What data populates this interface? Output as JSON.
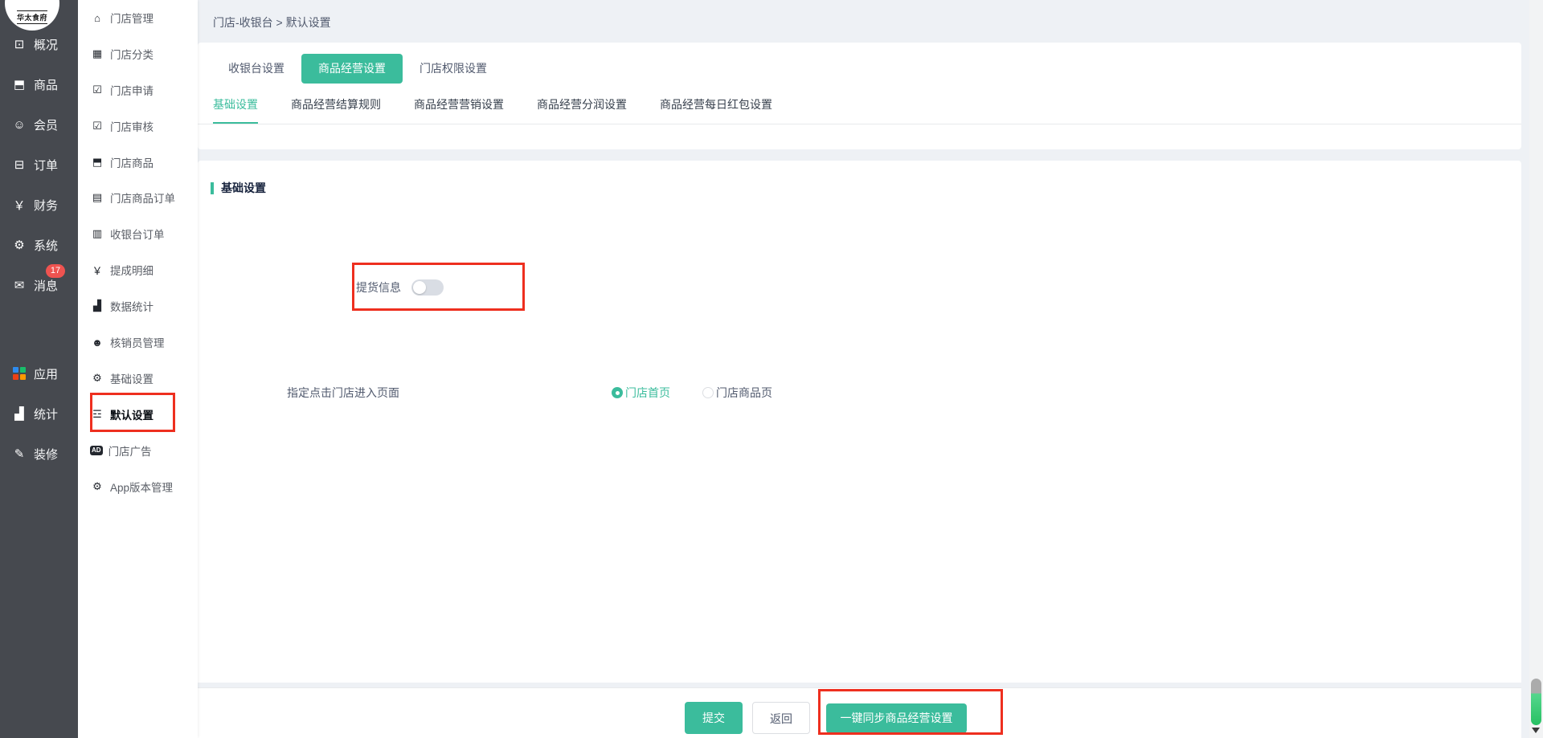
{
  "colors": {
    "accent": "#3bbc9c",
    "annotation_red": "#ee2f1f",
    "badge_red": "#ef5350",
    "sidebar_dark": "#46494f",
    "app_grid": [
      "#2d8cf0",
      "#19be6b",
      "#ed4014",
      "#ff9900"
    ]
  },
  "logo": {
    "text": "华太食府"
  },
  "primary_nav": [
    {
      "name": "overview",
      "label": "概况",
      "icon": "⊡"
    },
    {
      "name": "goods",
      "label": "商品",
      "icon": "⬒"
    },
    {
      "name": "members",
      "label": "会员",
      "icon": "☺"
    },
    {
      "name": "orders",
      "label": "订单",
      "icon": "⊟"
    },
    {
      "name": "finance",
      "label": "财务",
      "icon": "￥"
    },
    {
      "name": "system",
      "label": "系统",
      "icon": "⚙"
    },
    {
      "name": "messages",
      "label": "消息",
      "icon": "✉",
      "badge": "17"
    },
    {
      "name": "apps",
      "label": "应用",
      "icon_type": "app-grid"
    },
    {
      "name": "statistics",
      "label": "统计",
      "icon": "▟"
    },
    {
      "name": "decoration",
      "label": "装修",
      "icon": "✎"
    }
  ],
  "secondary_nav": [
    {
      "name": "store-management",
      "label": "门店管理",
      "icon": "⌂"
    },
    {
      "name": "store-category",
      "label": "门店分类",
      "icon": "▦"
    },
    {
      "name": "store-apply",
      "label": "门店申请",
      "icon": "☑"
    },
    {
      "name": "store-audit",
      "label": "门店审核",
      "icon": "☑"
    },
    {
      "name": "store-goods",
      "label": "门店商品",
      "icon": "⬒"
    },
    {
      "name": "store-goods-orders",
      "label": "门店商品订单",
      "icon": "▤"
    },
    {
      "name": "cashier-orders",
      "label": "收银台订单",
      "icon": "▥"
    },
    {
      "name": "commission-detail",
      "label": "提成明细",
      "icon": "￥"
    },
    {
      "name": "data-statistics",
      "label": "数据统计",
      "icon": "▟"
    },
    {
      "name": "verifier-management",
      "label": "核销员管理",
      "icon": "☻"
    },
    {
      "name": "basic-settings",
      "label": "基础设置",
      "icon": "⚙"
    },
    {
      "name": "default-settings",
      "label": "默认设置",
      "icon": "☲",
      "active": true
    },
    {
      "name": "store-ads",
      "label": "门店广告",
      "icon_type": "ad-badge",
      "icon_text": "AD"
    },
    {
      "name": "app-version",
      "label": "App版本管理",
      "icon": "⚙"
    }
  ],
  "breadcrumb": "门店-收银台 > 默认设置",
  "tabs": [
    {
      "label": "收银台设置"
    },
    {
      "label": "商品经营设置",
      "active": true
    },
    {
      "label": "门店权限设置"
    }
  ],
  "subtabs": [
    {
      "label": "基础设置",
      "active": true
    },
    {
      "label": "商品经营结算规则"
    },
    {
      "label": "商品经营营销设置"
    },
    {
      "label": "商品经营分润设置"
    },
    {
      "label": "商品经营每日红包设置"
    }
  ],
  "section": {
    "title": "基础设置"
  },
  "form": {
    "entry_label": "指定点击门店进入页面",
    "options": [
      {
        "label": "门店首页",
        "selected": true
      },
      {
        "label": "门店商品页",
        "selected": false
      }
    ],
    "pickup_label": "提货信息",
    "pickup_enabled": false
  },
  "footer": {
    "submit": "提交",
    "back": "返回",
    "sync": "一键同步商品经营设置"
  },
  "scrollbar": {
    "position": "bottom"
  }
}
